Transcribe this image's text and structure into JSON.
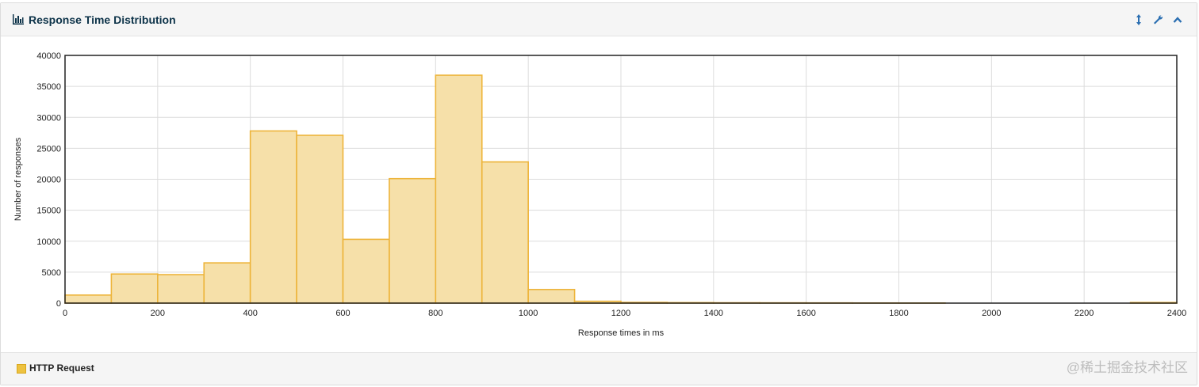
{
  "panel": {
    "title": "Response Time Distribution",
    "icons": [
      "bar-chart-icon",
      "vertical-resize-icon",
      "wrench-icon",
      "collapse-chevron-icon"
    ]
  },
  "legend": {
    "series_label": "HTTP Request",
    "swatch_color": "#edc240"
  },
  "watermark": "@稀土掘金技术社区",
  "chart_data": {
    "type": "bar",
    "xlabel": "Response times in ms",
    "ylabel": "Number of responses",
    "xlim": [
      0,
      2400
    ],
    "ylim": [
      0,
      40000
    ],
    "xticks": [
      0,
      200,
      400,
      600,
      800,
      1000,
      1200,
      1400,
      1600,
      1800,
      2000,
      2200,
      2400
    ],
    "yticks": [
      0,
      5000,
      10000,
      15000,
      20000,
      25000,
      30000,
      35000,
      40000
    ],
    "bin_width": 100,
    "grid": true,
    "bar_fill": "#f6e0a9",
    "bar_stroke": "#edb43a",
    "series": [
      {
        "name": "HTTP Request",
        "bins": [
          {
            "x": 0,
            "value": 1300
          },
          {
            "x": 100,
            "value": 4700
          },
          {
            "x": 200,
            "value": 4600
          },
          {
            "x": 300,
            "value": 6500
          },
          {
            "x": 400,
            "value": 27800
          },
          {
            "x": 500,
            "value": 27100
          },
          {
            "x": 600,
            "value": 10300
          },
          {
            "x": 700,
            "value": 20100
          },
          {
            "x": 800,
            "value": 36800
          },
          {
            "x": 900,
            "value": 22800
          },
          {
            "x": 1000,
            "value": 2200
          },
          {
            "x": 1100,
            "value": 300
          },
          {
            "x": 1200,
            "value": 120
          },
          {
            "x": 1300,
            "value": 80
          },
          {
            "x": 1400,
            "value": 60
          },
          {
            "x": 1500,
            "value": 50
          },
          {
            "x": 1600,
            "value": 40
          },
          {
            "x": 1700,
            "value": 30
          },
          {
            "x": 1800,
            "value": 20
          },
          {
            "x": 2300,
            "value": 100
          }
        ]
      }
    ]
  }
}
